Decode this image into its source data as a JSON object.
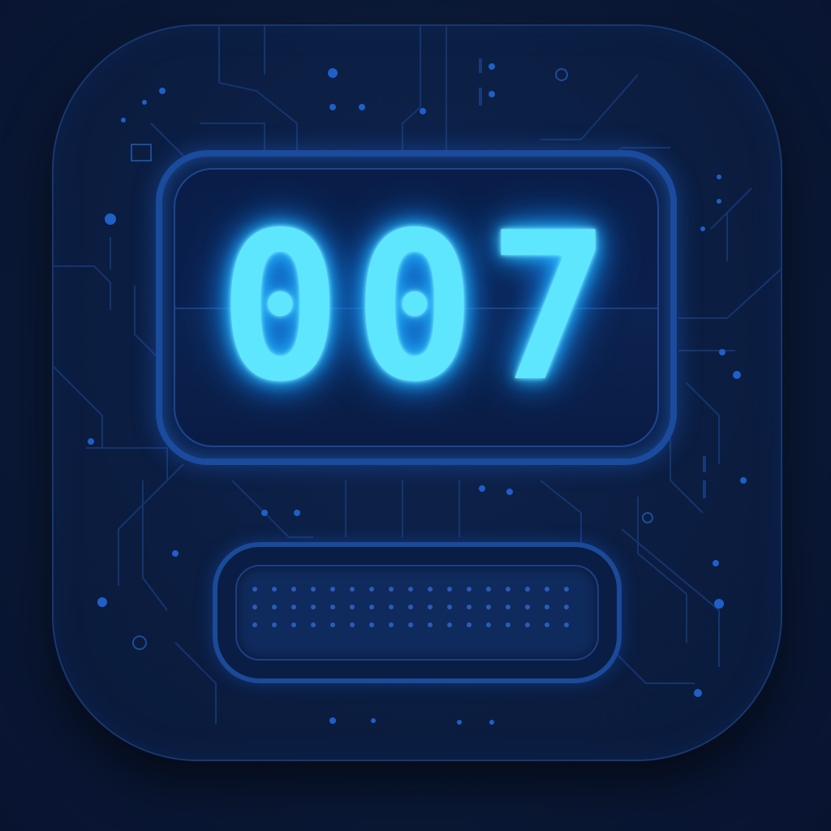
{
  "display": {
    "value": "007"
  },
  "icons": {
    "app_icon": "counter-app-icon",
    "speaker": "speaker-grille-icon"
  },
  "colors": {
    "background": "#0a1730",
    "digit_glow": "#5ee6ff",
    "frame_blue": "#1a4b9c"
  }
}
